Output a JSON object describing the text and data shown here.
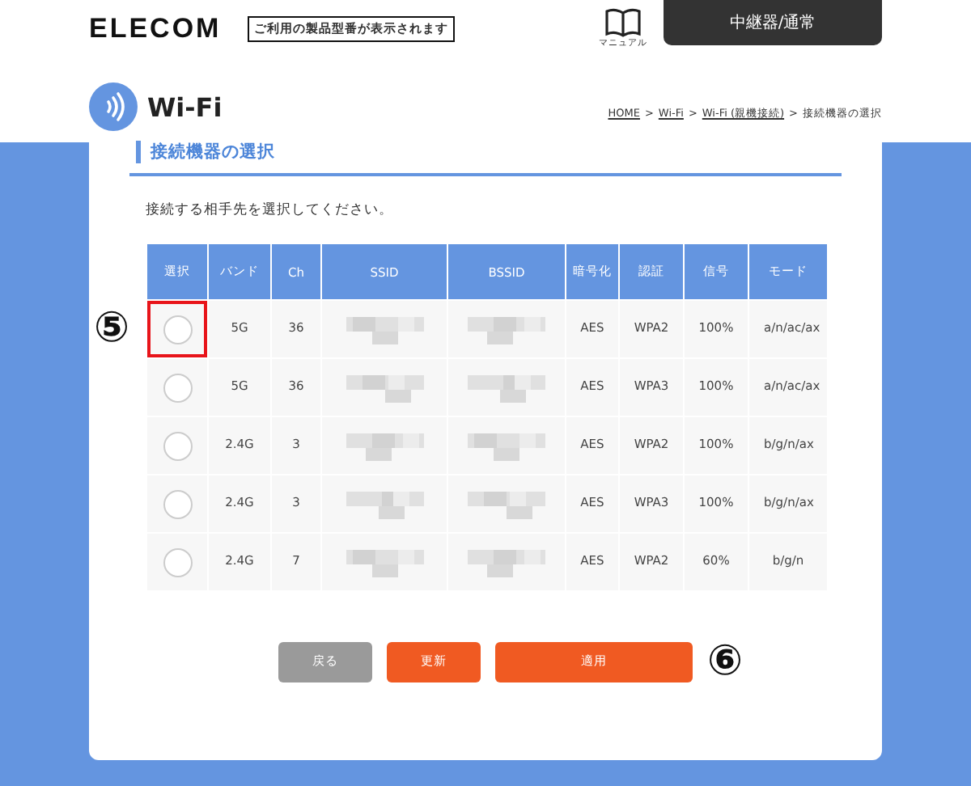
{
  "header": {
    "logo": "ELECOM",
    "model_notice": "ご利用の製品型番が表示されます",
    "manual_label": "マニュアル",
    "mode_tab": "中継器/通常"
  },
  "page": {
    "title": "Wi-Fi",
    "breadcrumb": [
      {
        "label": "HOME",
        "link": true
      },
      {
        "label": ">",
        "link": false
      },
      {
        "label": "Wi-Fi",
        "link": true
      },
      {
        "label": ">",
        "link": false
      },
      {
        "label": "Wi-Fi (親機接続)",
        "link": true
      },
      {
        "label": ">",
        "link": false
      },
      {
        "label": "接続機器の選択",
        "link": false
      }
    ]
  },
  "section": {
    "heading": "接続機器の選択",
    "instruction": "接続する相手先を選択してください。"
  },
  "table": {
    "columns": [
      "選択",
      "バンド",
      "Ch",
      "SSID",
      "BSSID",
      "暗号化",
      "認証",
      "信号",
      "モード"
    ],
    "rows": [
      {
        "selected": false,
        "highlighted": true,
        "band": "5G",
        "ch": "36",
        "encryption": "AES",
        "auth": "WPA2",
        "signal": "100%",
        "mode": "a/n/ac/ax"
      },
      {
        "selected": false,
        "highlighted": false,
        "band": "5G",
        "ch": "36",
        "encryption": "AES",
        "auth": "WPA3",
        "signal": "100%",
        "mode": "a/n/ac/ax"
      },
      {
        "selected": false,
        "highlighted": false,
        "band": "2.4G",
        "ch": "3",
        "encryption": "AES",
        "auth": "WPA2",
        "signal": "100%",
        "mode": "b/g/n/ax"
      },
      {
        "selected": false,
        "highlighted": false,
        "band": "2.4G",
        "ch": "3",
        "encryption": "AES",
        "auth": "WPA3",
        "signal": "100%",
        "mode": "b/g/n/ax"
      },
      {
        "selected": false,
        "highlighted": false,
        "band": "2.4G",
        "ch": "7",
        "encryption": "AES",
        "auth": "WPA2",
        "signal": "60%",
        "mode": "b/g/n"
      }
    ]
  },
  "buttons": [
    {
      "label": "戻る",
      "kind": "secondary"
    },
    {
      "label": "更新",
      "kind": "primary"
    },
    {
      "label": "適用",
      "kind": "wide"
    }
  ],
  "annotations": {
    "table": "⑤",
    "buttons": "⑥"
  }
}
